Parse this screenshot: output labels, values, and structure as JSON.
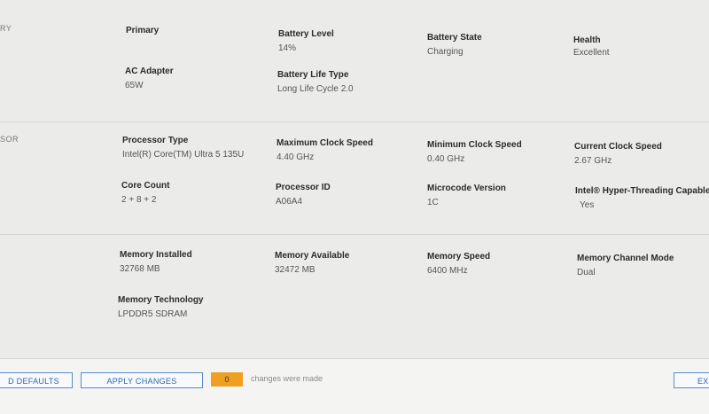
{
  "battery": {
    "section_label": "RY",
    "primary_label": "Primary",
    "battery_level": {
      "label": "Battery Level",
      "value": "14%"
    },
    "battery_state": {
      "label": "Battery State",
      "value": "Charging"
    },
    "health": {
      "label": "Health",
      "value": "Excellent"
    },
    "ac_adapter": {
      "label": "AC Adapter",
      "value": "65W"
    },
    "life_type": {
      "label": "Battery Life Type",
      "value": "Long Life Cycle 2.0"
    }
  },
  "processor": {
    "section_label": "SOR",
    "processor_type": {
      "label": "Processor Type",
      "value": "Intel(R) Core(TM) Ultra 5 135U"
    },
    "max_clock": {
      "label": "Maximum Clock Speed",
      "value": "4.40 GHz"
    },
    "min_clock": {
      "label": "Minimum Clock Speed",
      "value": "0.40 GHz"
    },
    "current_clock": {
      "label": "Current Clock Speed",
      "value": "2.67 GHz"
    },
    "core_count": {
      "label": "Core Count",
      "value": "2 + 8 + 2"
    },
    "processor_id": {
      "label": "Processor ID",
      "value": "A06A4"
    },
    "microcode": {
      "label": "Microcode Version",
      "value": "1C"
    },
    "hyperthreading": {
      "label": "Intel® Hyper-Threading Capable",
      "value": "Yes"
    }
  },
  "memory": {
    "installed": {
      "label": "Memory Installed",
      "value": "32768 MB"
    },
    "available": {
      "label": "Memory Available",
      "value": "32472 MB"
    },
    "speed": {
      "label": "Memory Speed",
      "value": "6400 MHz"
    },
    "channel_mode": {
      "label": "Memory Channel Mode",
      "value": "Dual"
    },
    "technology": {
      "label": "Memory Technology",
      "value": "LPDDR5 SDRAM"
    }
  },
  "footer": {
    "defaults_label": "D DEFAULTS",
    "apply_label": "APPLY CHANGES",
    "changes_count": "0",
    "changes_text": "changes were made",
    "exit_label": "EXI"
  },
  "colors": {
    "accent": "#2f66b0",
    "badge": "#f0a020",
    "background": "#ebebea"
  }
}
